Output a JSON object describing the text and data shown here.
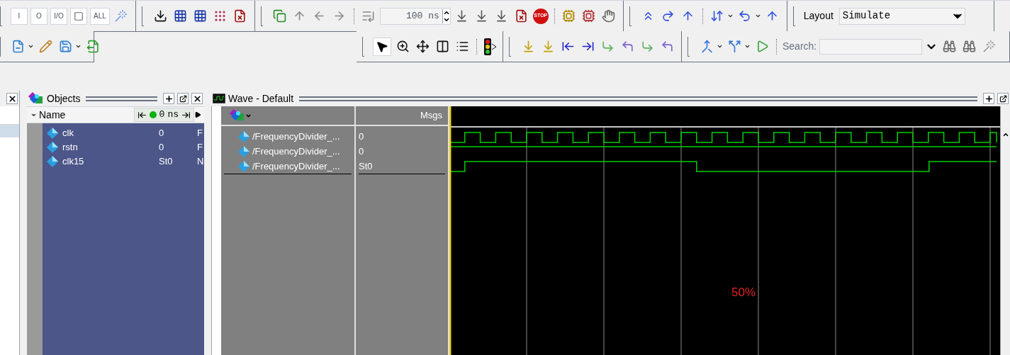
{
  "toolbar": {
    "filter_buttons": [
      "I",
      "O",
      "I/O",
      "ALL"
    ],
    "run_length": "100 ns",
    "stop_label": "STOP",
    "layout_label": "Layout",
    "layout_value": "Simulate",
    "search_label": "Search:",
    "pointer_selected": true
  },
  "left_panel": {
    "first_row_selected": true
  },
  "objects": {
    "title": "Objects",
    "header": {
      "name": "Name",
      "time": "0",
      "unit": "ns"
    },
    "rows": [
      {
        "name": "clk",
        "value": "0",
        "column_3": "F"
      },
      {
        "name": "rstn",
        "value": "0",
        "column_3": "F"
      },
      {
        "name": "clk15",
        "value": "St0",
        "column_3": "N"
      }
    ]
  },
  "wave": {
    "title": "Wave - Default",
    "msgs_header": "Msgs",
    "rows": [
      {
        "name": "/FrequencyDivider_...",
        "value": "0"
      },
      {
        "name": "/FrequencyDivider_...",
        "value": "0"
      },
      {
        "name": "/FrequencyDivider_...",
        "value": "St0"
      }
    ],
    "note": "50%"
  }
}
